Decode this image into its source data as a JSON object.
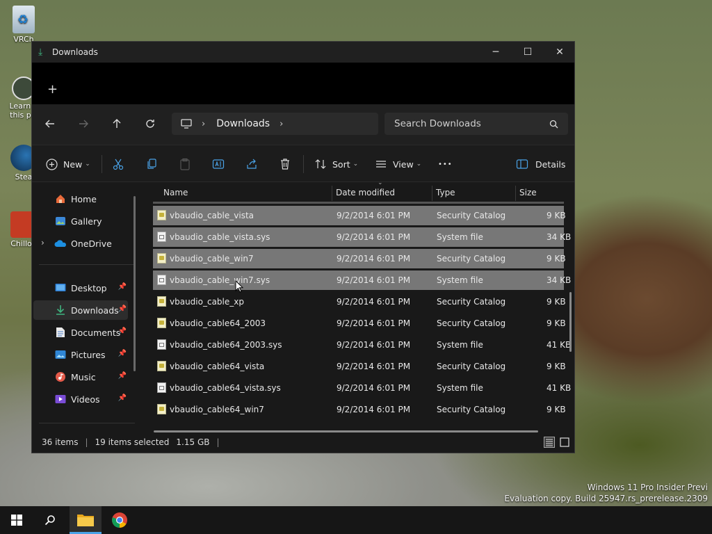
{
  "desktop": {
    "icons": [
      {
        "label": "VRCh",
        "icon": "recycle-bin-icon"
      },
      {
        "label": "Learn a this pic",
        "icon": "learn-picture-icon"
      },
      {
        "label": "Stea",
        "icon": "steam-icon"
      },
      {
        "label": "Chillou",
        "icon": "chillout-icon"
      }
    ],
    "watermark": {
      "line1": "Windows 11 Pro Insider Previ",
      "line2": "Evaluation copy. Build 25947.rs_prerelease.2309"
    }
  },
  "window": {
    "title": "Downloads",
    "title_icon": "download-icon",
    "controls": {
      "minimize": "─",
      "maximize": "☐",
      "close": "✕"
    },
    "new_tab": "+"
  },
  "nav": {
    "breadcrumb_item": "Downloads",
    "search_placeholder": "Search Downloads"
  },
  "command_bar": {
    "new_label": "New",
    "sort_label": "Sort",
    "view_label": "View",
    "more_label": "•••",
    "details_label": "Details"
  },
  "sidebar": {
    "items": [
      {
        "label": "Home",
        "icon": "home-icon",
        "pinned": false
      },
      {
        "label": "Gallery",
        "icon": "gallery-icon",
        "pinned": false
      },
      {
        "label": "OneDrive",
        "icon": "onedrive-icon",
        "pinned": false
      },
      {
        "label": "Desktop",
        "icon": "desktop-icon",
        "pinned": true
      },
      {
        "label": "Downloads",
        "icon": "download-icon",
        "pinned": true
      },
      {
        "label": "Documents",
        "icon": "documents-icon",
        "pinned": true
      },
      {
        "label": "Pictures",
        "icon": "pictures-icon",
        "pinned": true
      },
      {
        "label": "Music",
        "icon": "music-icon",
        "pinned": true
      },
      {
        "label": "Videos",
        "icon": "videos-icon",
        "pinned": true
      }
    ]
  },
  "file_list": {
    "columns": [
      "Name",
      "Date modified",
      "Type",
      "Size"
    ],
    "rows": [
      {
        "name": "vbaudio_cable_vista",
        "date": "9/2/2014 6:01 PM",
        "type": "Security Catalog",
        "size": "9 KB",
        "selected": true,
        "kind": "cat"
      },
      {
        "name": "vbaudio_cable_vista.sys",
        "date": "9/2/2014 6:01 PM",
        "type": "System file",
        "size": "34 KB",
        "selected": true,
        "kind": "sys"
      },
      {
        "name": "vbaudio_cable_win7",
        "date": "9/2/2014 6:01 PM",
        "type": "Security Catalog",
        "size": "9 KB",
        "selected": true,
        "kind": "cat"
      },
      {
        "name": "vbaudio_cable_win7.sys",
        "date": "9/2/2014 6:01 PM",
        "type": "System file",
        "size": "34 KB",
        "selected": true,
        "kind": "sys"
      },
      {
        "name": "vbaudio_cable_xp",
        "date": "9/2/2014 6:01 PM",
        "type": "Security Catalog",
        "size": "9 KB",
        "selected": false,
        "kind": "cat"
      },
      {
        "name": "vbaudio_cable64_2003",
        "date": "9/2/2014 6:01 PM",
        "type": "Security Catalog",
        "size": "9 KB",
        "selected": false,
        "kind": "cat"
      },
      {
        "name": "vbaudio_cable64_2003.sys",
        "date": "9/2/2014 6:01 PM",
        "type": "System file",
        "size": "41 KB",
        "selected": false,
        "kind": "sys"
      },
      {
        "name": "vbaudio_cable64_vista",
        "date": "9/2/2014 6:01 PM",
        "type": "Security Catalog",
        "size": "9 KB",
        "selected": false,
        "kind": "cat"
      },
      {
        "name": "vbaudio_cable64_vista.sys",
        "date": "9/2/2014 6:01 PM",
        "type": "System file",
        "size": "41 KB",
        "selected": false,
        "kind": "sys"
      },
      {
        "name": "vbaudio_cable64_win7",
        "date": "9/2/2014 6:01 PM",
        "type": "Security Catalog",
        "size": "9 KB",
        "selected": false,
        "kind": "cat"
      }
    ]
  },
  "status": {
    "items_count": "36 items",
    "selected": "19 items selected",
    "size": "1.15 GB"
  },
  "colors": {
    "accent": "#3fb37f",
    "selected_row": "#777777",
    "window_bg": "#191919"
  }
}
